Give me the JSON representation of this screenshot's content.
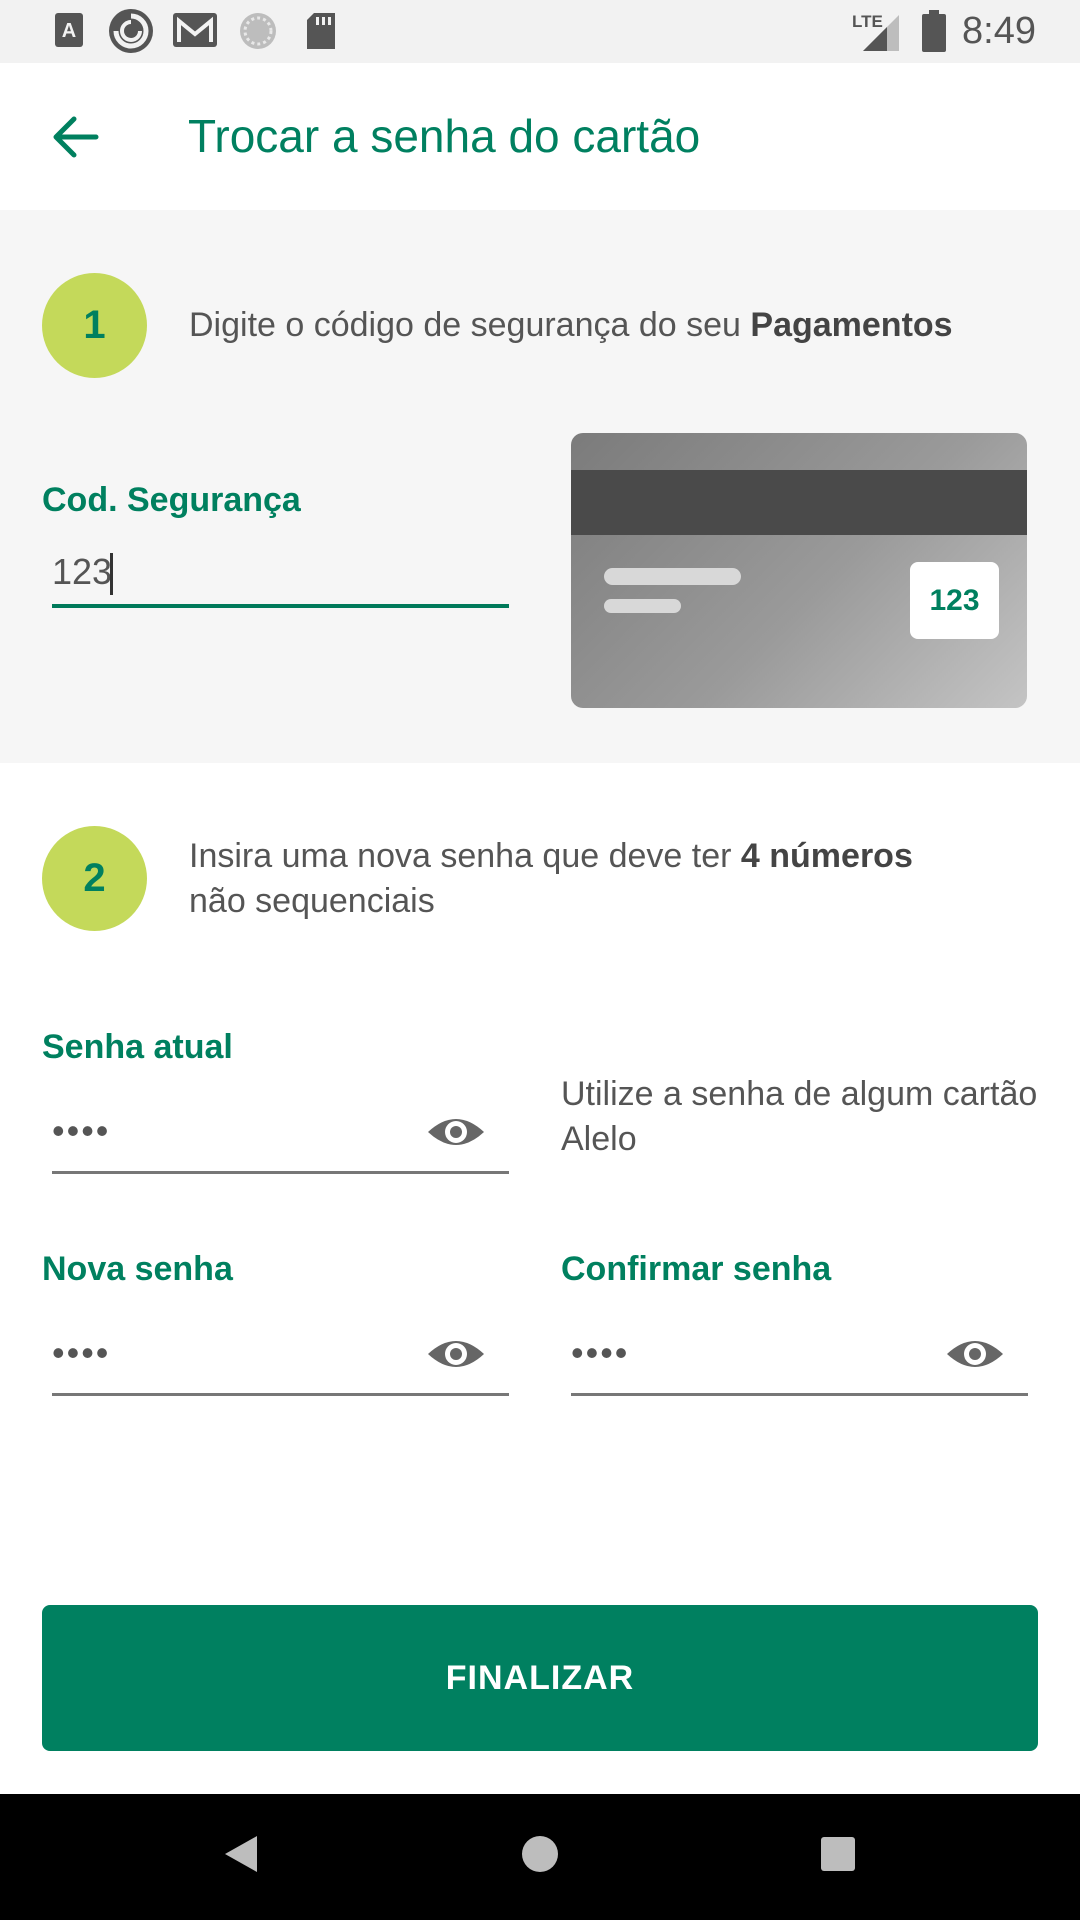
{
  "status_bar": {
    "time": "8:49",
    "network": "LTE",
    "icons": [
      "a-notification-icon",
      "sync-app-icon",
      "gmail-icon",
      "loading-icon",
      "sd-card-icon",
      "signal-icon",
      "battery-icon"
    ]
  },
  "app_bar": {
    "title": "Trocar a senha do cartão",
    "back_icon": "arrow-back-icon"
  },
  "step1": {
    "number": "1",
    "text": "Digite o código de segurança do seu ",
    "text_bold": "Pagamentos",
    "field_label": "Cod. Segurança",
    "field_value": "123",
    "card_cvv": "123"
  },
  "step2": {
    "number": "2",
    "text": "Insira uma nova senha que deve ter ",
    "text_bold": "4 números",
    "text_end": "não sequenciais"
  },
  "fields": {
    "current_label": "Senha atual",
    "current_value": "••••",
    "hint": "Utilize a senha de algum cartão Alelo",
    "new_label": "Nova senha",
    "new_value": "••••",
    "confirm_label": "Confirmar senha",
    "confirm_value": "••••"
  },
  "actions": {
    "finalize_label": "FINALIZAR"
  },
  "colors": {
    "primary": "#008060",
    "step_circle": "#c4d95a",
    "background_section": "#f6f6f6"
  }
}
